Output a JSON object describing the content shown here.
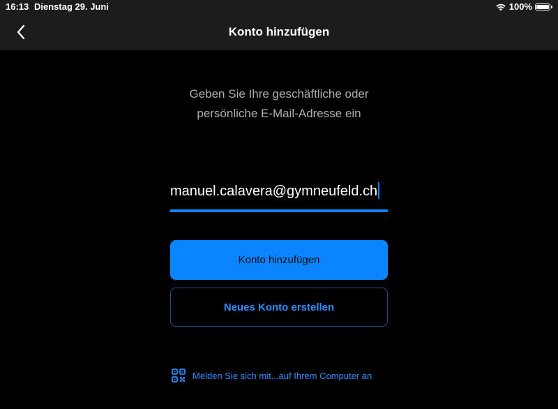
{
  "status_bar": {
    "time": "16:13",
    "date": "Dienstag 29. Juni",
    "battery_text": "100%",
    "battery_level": 1.0
  },
  "nav": {
    "back_icon": "chevron-left-icon",
    "title": "Konto hinzufügen"
  },
  "instruction": {
    "line1": "Geben Sie Ihre geschäftliche oder",
    "line2": "persönliche E-Mail-Adresse ein"
  },
  "email_input": {
    "value": "manuel.calavera@gymneufeld.ch"
  },
  "buttons": {
    "add_account": "Konto hinzufügen",
    "create_account": "Neues Konto erstellen"
  },
  "qr_signin": {
    "icon": "qr-code-icon",
    "label": "Melden Sie sich mit...auf Ihrem Computer an"
  },
  "colors": {
    "accent": "#0a84ff",
    "bar_background": "#1c1c1e",
    "background": "#000000",
    "secondary_text": "#aeaeb2"
  }
}
